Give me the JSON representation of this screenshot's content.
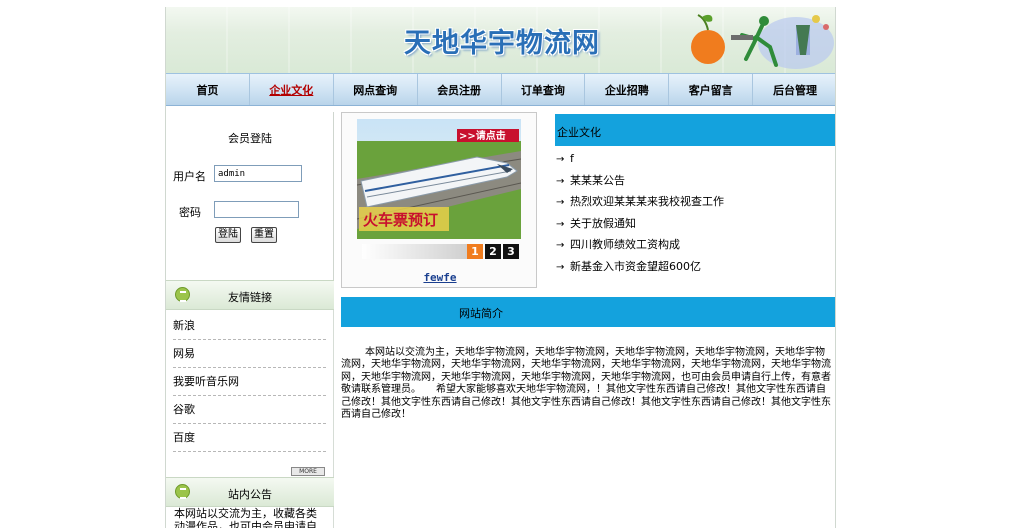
{
  "header": {
    "title": "天地华宇物流网"
  },
  "nav": [
    {
      "label": "首页",
      "active": false
    },
    {
      "label": "企业文化",
      "active": true
    },
    {
      "label": "网点查询",
      "active": false
    },
    {
      "label": "会员注册",
      "active": false
    },
    {
      "label": "订单查询",
      "active": false
    },
    {
      "label": "企业招聘",
      "active": false
    },
    {
      "label": "客户留言",
      "active": false
    },
    {
      "label": "后台管理",
      "active": false
    }
  ],
  "login": {
    "title": "会员登陆",
    "username_label": "用户名",
    "username_value": "admin",
    "password_label": "密码",
    "password_value": "",
    "login_button": "登陆",
    "reset_button": "重置"
  },
  "links": {
    "title": "友情链接",
    "items": [
      "新浪",
      "网易",
      "我要听音乐网",
      "谷歌",
      "百度"
    ],
    "more_label": "MORE"
  },
  "notice": {
    "title": "站内公告",
    "text": "本网站以交流为主，收藏各类动漫作品，也可由会员申请自行"
  },
  "banner": {
    "click_label": ">>请点击",
    "promo_label": "火车票预订",
    "slides": [
      "1",
      "2",
      "3"
    ],
    "caption": "fewfe"
  },
  "news": {
    "title": "企业文化",
    "items": [
      "f",
      "某某某公告",
      "热烈欢迎某某某来我校视查工作",
      "关于放假通知",
      "四川教师绩效工资构成",
      "新基金入市资金望超600亿"
    ]
  },
  "intro": {
    "title": "网站简介",
    "text": "本网站以交流为主，天地华宇物流网，天地华宇物流网，天地华宇物流网，天地华宇物流网，天地华宇物流网，天地华宇物流网，天地华宇物流网，天地华宇物流网，天地华宇物流网，天地华宇物流网，天地华宇物流网，天地华宇物流网，天地华宇物流网，天地华宇物流网，天地华宇物流网，也可由会员申请自行上传，有意者敬请联系管理员。　　希望大家能够喜欢天地华宇物流网，！其他文字性东西请自己修改！其他文字性东西请自己修改！其他文字性东西请自己修改！其他文字性东西请自己修改！其他文字性东西请自己修改！其他文字性东西请自己修改！"
  },
  "colors": {
    "accent": "#14a2dd",
    "title": "#2a6fb7",
    "active_nav": "#b30000"
  }
}
